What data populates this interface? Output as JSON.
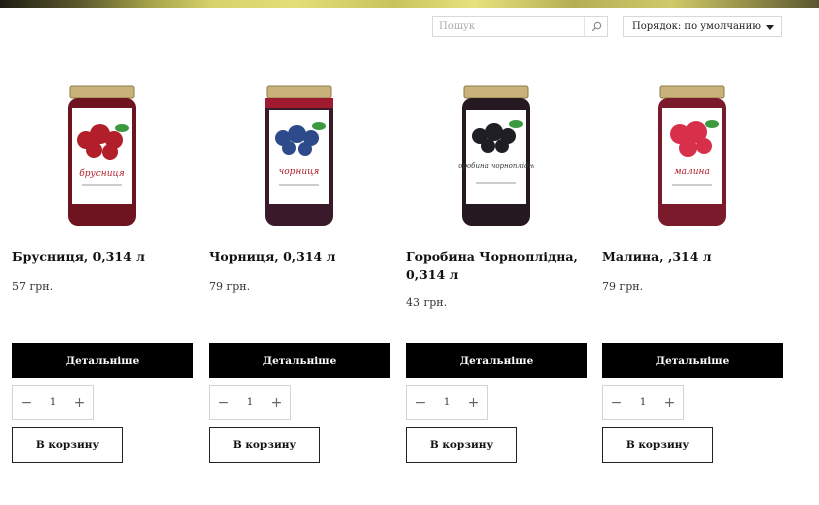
{
  "search": {
    "placeholder": "Пошук",
    "icon": "search-icon"
  },
  "sort": {
    "label": "Порядок: по умолчанию"
  },
  "products": [
    {
      "name": "Брусниця, 0,314 л",
      "price": "57 грн.",
      "details_label": "Детальніше",
      "quantity": "1",
      "cart_label": "В корзину",
      "jar_label": "брусниця",
      "fruit_color": "#b21f2a",
      "jam_color": "#6e1420",
      "leaf_color": "#3c9a3e"
    },
    {
      "name": "Чорниця, 0,314 л",
      "price": "79 грн.",
      "details_label": "Детальніше",
      "quantity": "1",
      "cart_label": "В корзину",
      "jar_label": "чорниця",
      "fruit_color": "#2d4a8a",
      "jam_color": "#3a1a2a",
      "leaf_color": "#3c9a3e"
    },
    {
      "name": "Горобина Чорноплідна, 0,314 л",
      "price": "43 грн.",
      "details_label": "Детальніше",
      "quantity": "1",
      "cart_label": "В корзину",
      "jar_label": "горобина чорноплідна",
      "fruit_color": "#1e1e24",
      "jam_color": "#251820",
      "leaf_color": "#3c9a3e"
    },
    {
      "name": "Малина, ,314 л",
      "price": "79 грн.",
      "details_label": "Детальніше",
      "quantity": "1",
      "cart_label": "В корзину",
      "jar_label": "малина",
      "fruit_color": "#d8304a",
      "jam_color": "#7a1a2a",
      "leaf_color": "#3c9a3e"
    }
  ]
}
